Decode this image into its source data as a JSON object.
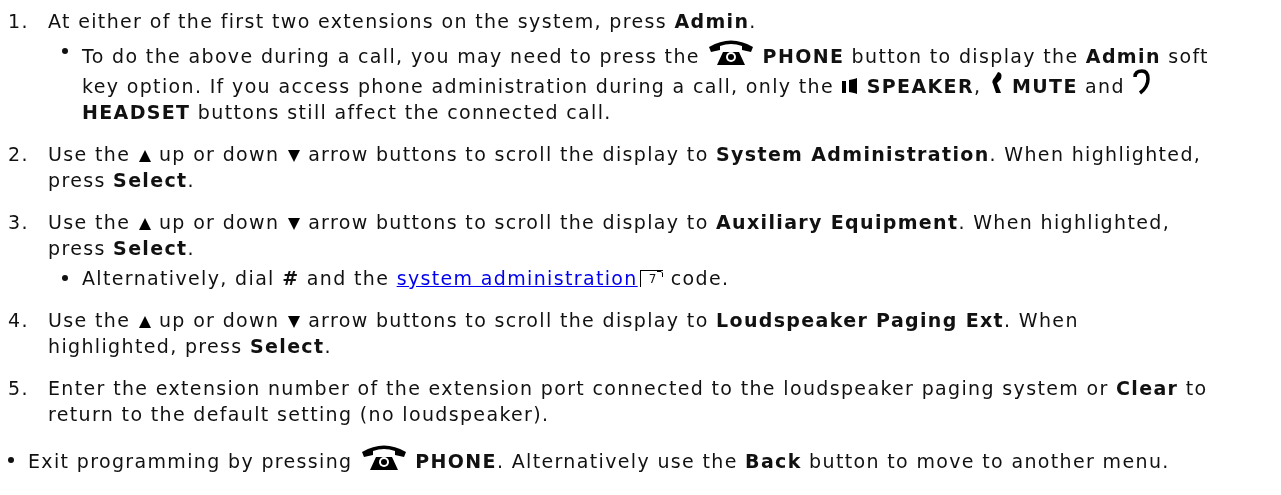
{
  "steps": [
    {
      "number": "1.",
      "parts": [
        {
          "kind": "text",
          "text": "At either of the first two extensions on the system, press **Admin**."
        }
      ],
      "notes": [
        {
          "parts": [
            {
              "kind": "text",
              "text": "To do the above during a call, you may need to press the"
            },
            {
              "kind": "phone"
            },
            {
              "kind": "text",
              "text": "**PHONE** button to display the **Admin** soft"
            },
            {
              "kind": "text",
              "text": "key option. If you access phone administration during a call, only the"
            },
            {
              "kind": "speaker"
            },
            {
              "kind": "text",
              "text": "**SPEAKER**,"
            },
            {
              "kind": "mute"
            },
            {
              "kind": "text",
              "text": "**MUTE** and"
            },
            {
              "kind": "headset"
            },
            {
              "kind": "text",
              "text": "**HEADSET** buttons still affect the connected call."
            }
          ]
        }
      ]
    },
    {
      "number": "2.",
      "parts": [
        {
          "kind": "text",
          "text": "Use the"
        },
        {
          "kind": "up"
        },
        {
          "kind": "text",
          "text": "up or down"
        },
        {
          "kind": "down"
        },
        {
          "kind": "text",
          "text": "arrow buttons to scroll the display to **System Administration**. When highlighted,"
        },
        {
          "kind": "text",
          "text": "press **Select**."
        }
      ]
    },
    {
      "number": "3.",
      "parts": [
        {
          "kind": "text",
          "text": "Use the"
        },
        {
          "kind": "up"
        },
        {
          "kind": "text",
          "text": "up or down"
        },
        {
          "kind": "down"
        },
        {
          "kind": "text",
          "text": "arrow buttons to scroll the display to **Auxiliary Equipment**. When highlighted,"
        },
        {
          "kind": "text",
          "text": "press **Select**."
        }
      ],
      "notes": [
        {
          "parts": [
            {
              "kind": "text",
              "text": "Alternatively, dial **#** and the"
            },
            {
              "kind": "link",
              "text": "system administration"
            },
            {
              "kind": "ref",
              "text": "7"
            },
            {
              "kind": "text",
              "text": "code."
            }
          ]
        }
      ]
    },
    {
      "number": "4.",
      "parts": [
        {
          "kind": "text",
          "text": "Use the"
        },
        {
          "kind": "up"
        },
        {
          "kind": "text",
          "text": "up or down"
        },
        {
          "kind": "down"
        },
        {
          "kind": "text",
          "text": "arrow buttons to scroll the display to **Loudspeaker Paging Ext**. When"
        },
        {
          "kind": "text",
          "text": "highlighted, press **Select**."
        }
      ]
    },
    {
      "number": "5.",
      "parts": [
        {
          "kind": "text",
          "text": "Enter the extension number of the extension port connected to the loudspeaker paging system or **Clear** to"
        },
        {
          "kind": "text",
          "text": "return to the default setting (no loudspeaker)."
        }
      ]
    }
  ],
  "closing_notes": [
    {
      "parts": [
        {
          "kind": "text",
          "text": "Exit programming by pressing"
        },
        {
          "kind": "phone"
        },
        {
          "kind": "text",
          "text": "**PHONE**. Alternatively use the **Back** button to move to another menu."
        }
      ]
    }
  ]
}
